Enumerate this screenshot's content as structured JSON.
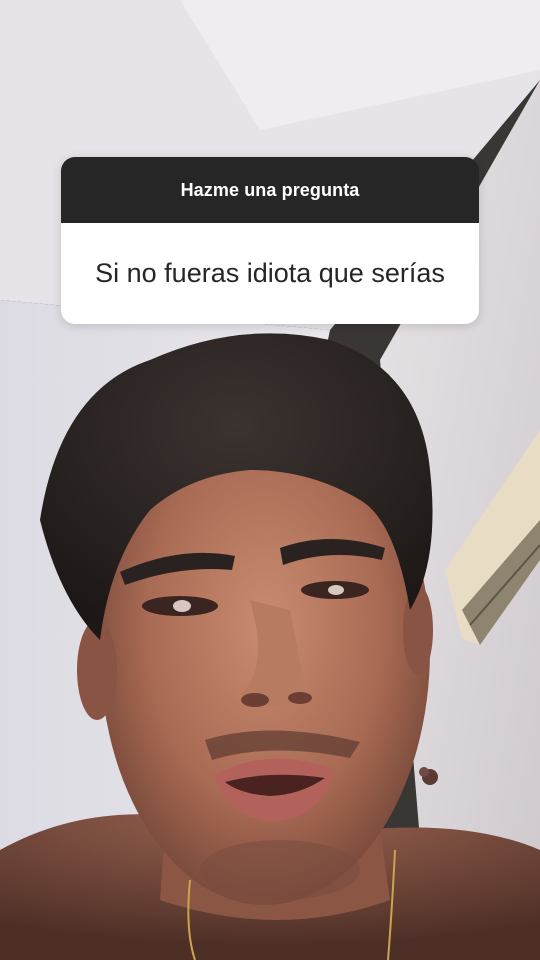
{
  "question_sticker": {
    "header": "Hazme una pregunta",
    "question": "Si no fueras idiota que serías",
    "header_color": "#262626",
    "body_color": "#ffffff"
  },
  "background": {
    "description_icon": "selfie-photo"
  }
}
